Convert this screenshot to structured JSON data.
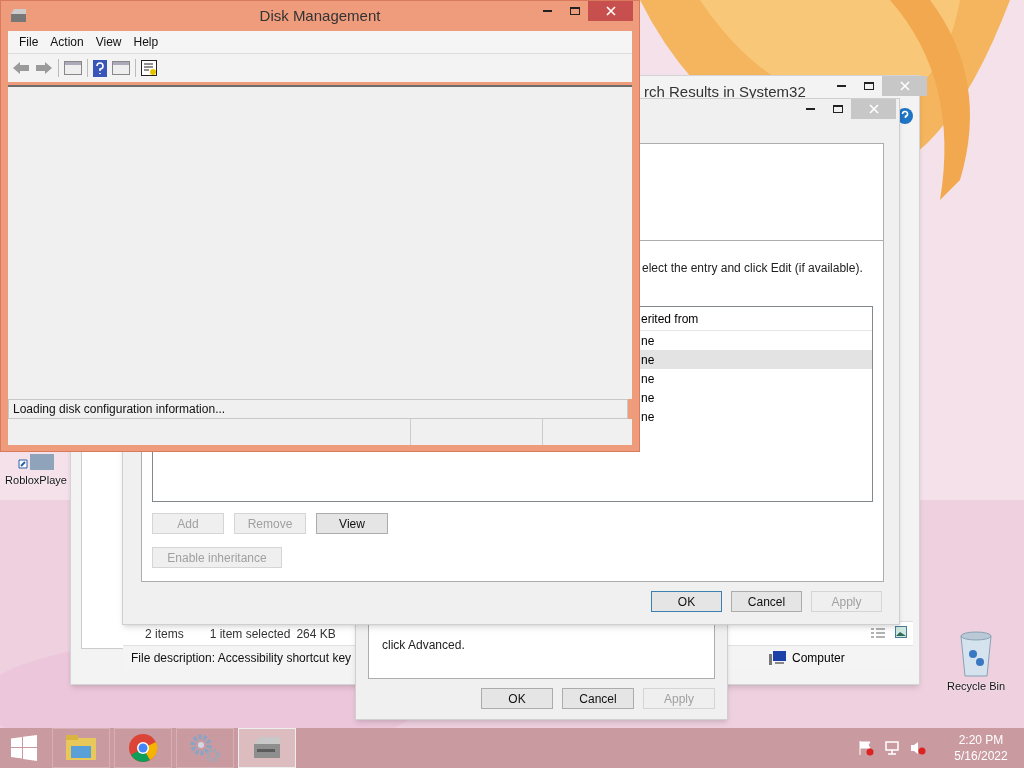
{
  "desktop_icons": [
    {
      "kind": "app",
      "label": "RobloxPlaye"
    },
    {
      "kind": "recycle",
      "label": "Recycle Bin"
    }
  ],
  "explorer": {
    "title": "rch Results in System32",
    "status": [
      "2 items",
      "1 item selected",
      "264 KB"
    ],
    "details": "File description: Accessibility shortcut key",
    "location": "Computer"
  },
  "properties_dialog": {
    "text": "click Advanced.",
    "buttons": [
      {
        "label": "OK",
        "disabled": false,
        "default": false
      },
      {
        "label": "Cancel",
        "disabled": false,
        "default": false
      },
      {
        "label": "Apply",
        "disabled": true,
        "default": false
      }
    ]
  },
  "permissions_dialog": {
    "instruction": "elect the entry and click Edit (if available).",
    "column": "erited from",
    "rows": [
      {
        "text": "ne",
        "selected": false
      },
      {
        "text": "ne",
        "selected": true
      },
      {
        "text": "ne",
        "selected": false
      },
      {
        "text": "ne",
        "selected": false
      },
      {
        "text": "ne",
        "selected": false
      }
    ],
    "list_buttons": [
      {
        "label": "Add",
        "disabled": true,
        "default": false
      },
      {
        "label": "Remove",
        "disabled": true,
        "default": false
      },
      {
        "label": "View",
        "disabled": false,
        "default": false
      }
    ],
    "inheritance_button": {
      "label": "Enable inheritance",
      "disabled": true,
      "default": false
    },
    "buttons": [
      {
        "label": "OK",
        "disabled": false,
        "default": true
      },
      {
        "label": "Cancel",
        "disabled": false,
        "default": false
      },
      {
        "label": "Apply",
        "disabled": true,
        "default": false
      }
    ]
  },
  "disk_management": {
    "title": "Disk Management",
    "menu": [
      "File",
      "Action",
      "View",
      "Help"
    ],
    "status": "Loading disk configuration information..."
  },
  "taskbar": {
    "apps": [
      {
        "kind": "explorer",
        "selected": false
      },
      {
        "kind": "browser",
        "selected": false
      },
      {
        "kind": "settings",
        "selected": false
      },
      {
        "kind": "disk",
        "selected": true
      }
    ],
    "time": "2:20 PM",
    "date": "5/16/2022"
  }
}
